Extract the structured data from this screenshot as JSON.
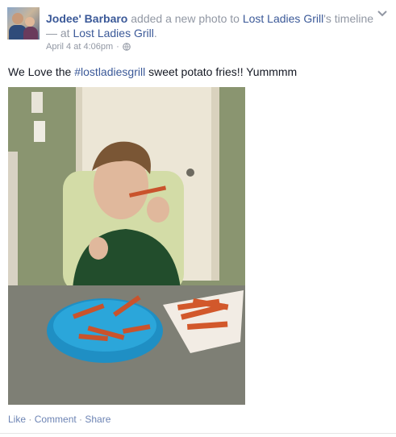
{
  "post": {
    "author": "Jodee' Barbaro",
    "action_text": "added a new photo to",
    "target_page": "Lost Ladies Grill",
    "target_suffix": "'s timeline",
    "location_prefix": "— at",
    "location": "Lost Ladies Grill",
    "location_suffix": ".",
    "timestamp": "April 4 at 4:06pm",
    "separator": "·",
    "privacy_icon": "globe-icon",
    "message_before": "We Love the ",
    "hashtag": "#lostladiesgrill",
    "message_after": " sweet potato fries!! Yummmm",
    "photo_icon": "toddler-eating-sweet-potato-fries"
  },
  "actions": {
    "like": "Like",
    "sep1": " · ",
    "comment": "Comment",
    "sep2": " · ",
    "share": "Share"
  },
  "colors": {
    "link": "#3b5998",
    "meta_gray": "#9197a3",
    "text": "#141823"
  }
}
